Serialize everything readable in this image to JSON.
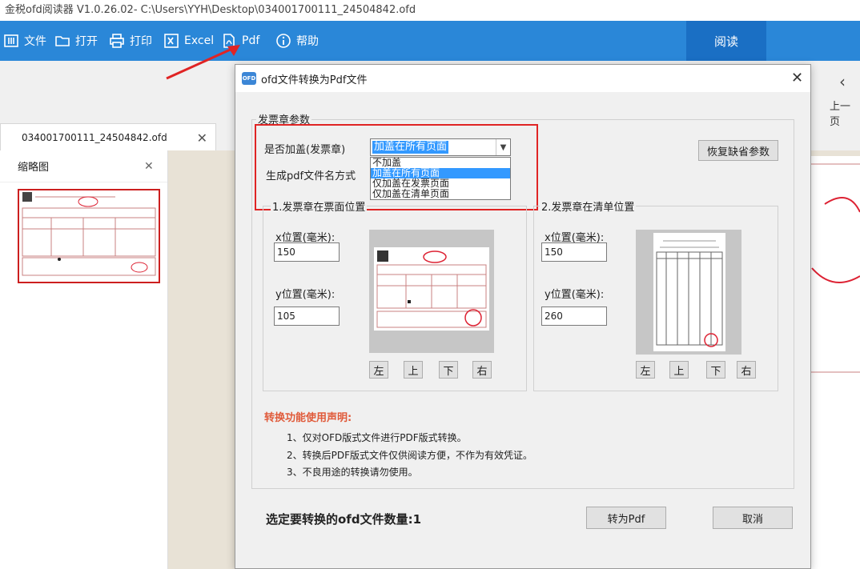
{
  "window": {
    "title": "金税ofd阅读器 V1.0.26.02- C:\\Users\\YYH\\Desktop\\034001700111_24504842.ofd"
  },
  "toolbar": {
    "items": [
      {
        "label": "文件",
        "icon": "file-icon"
      },
      {
        "label": "打开",
        "icon": "folder-icon"
      },
      {
        "label": "打印",
        "icon": "printer-icon"
      },
      {
        "label": "Excel",
        "icon": "excel-icon"
      },
      {
        "label": "Pdf",
        "icon": "pdf-icon"
      },
      {
        "label": "帮助",
        "icon": "help-icon"
      }
    ],
    "read_label": "阅读"
  },
  "nav": {
    "prev_page": "上一页"
  },
  "doc_tab": {
    "label": "034001700111_24504842.ofd"
  },
  "side_panel": {
    "title": "缩略图"
  },
  "dialog": {
    "title": "ofd文件转换为Pdf文件",
    "group_title": "发票章参数",
    "stamp_label": "是否加盖(发票章)",
    "stamp_selected": "加盖在所有页面",
    "stamp_options": [
      "不加盖",
      "加盖在所有页面",
      "仅加盖在发票页面",
      "仅加盖在清单页面"
    ],
    "filename_label": "生成pdf文件名方式",
    "restore_button": "恢复缺省参数",
    "invoice_group": {
      "title": "1.发票章在票面位置",
      "x_label": "x位置(毫米):",
      "x_value": "150",
      "y_label": "y位置(毫米):",
      "y_value": "105"
    },
    "list_group": {
      "title": "2.发票章在清单位置",
      "x_label": "x位置(毫米):",
      "x_value": "150",
      "y_label": "y位置(毫米):",
      "y_value": "260"
    },
    "direction_buttons": {
      "left": "左",
      "up": "上",
      "down": "下",
      "right": "右"
    },
    "notice_title": "转换功能使用声明:",
    "notice_lines": [
      "1、仅对OFD版式文件进行PDF版式转换。",
      "2、转换后PDF版式文件仅供阅读方便，不作为有效凭证。",
      "3、不良用途的转换请勿使用。"
    ],
    "count_label": "选定要转换的ofd文件数量:1",
    "convert_button": "转为Pdf",
    "cancel_button": "取消"
  },
  "colors": {
    "toolbar": "#2a87d8",
    "read_tab": "#1a6fc4",
    "highlight": "#e02424",
    "selection": "#3399ff",
    "notice": "#e05a3a"
  }
}
